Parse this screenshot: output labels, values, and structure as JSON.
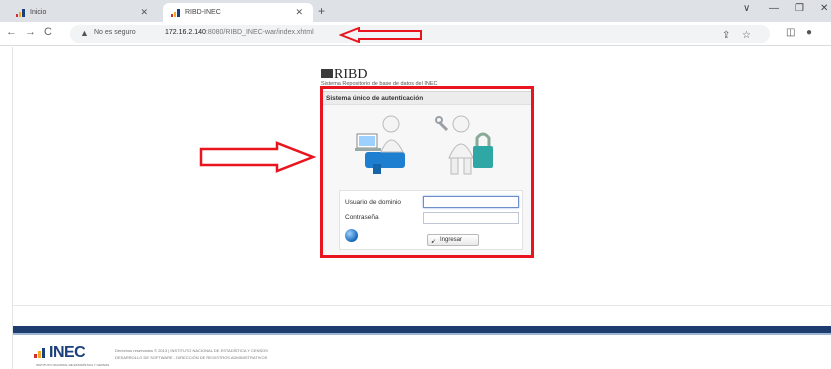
{
  "browser": {
    "tabs": [
      {
        "label": "Inicio",
        "active": false
      },
      {
        "label": "RIBD-INEC",
        "active": true
      }
    ],
    "new_tab_label": "+",
    "address": {
      "security_label": "No es seguro",
      "url_host": "172.16.2.140",
      "url_path": ":8080/RIBD_INEC-war/index.xhtml"
    },
    "window_controls": [
      "∨",
      "—",
      "❐",
      "✕"
    ]
  },
  "page": {
    "app_name": "RIBD",
    "app_subtitle": "Sistema Repositorio de base de datos del INEC",
    "login": {
      "title": "Sistema único de autenticación",
      "username_label": "Usuario de dominio",
      "username_value": "",
      "password_label": "Contraseña",
      "password_value": "",
      "submit_label": "Ingresar"
    },
    "footer": {
      "logo_text": "INEC",
      "logo_tagline": "INSTITUTO NACIONAL DE ESTADÍSTICA Y CENSOS",
      "copyright": "Derechos reservados © 2013 | INSTITUTO NACIONAL DE ESTADÍSTICA Y CENSOS",
      "dev_credit": "DESARROLLO DE SOFTWARE - DIRECCIÓN DE REGISTROS ADMINISTRATIVOS"
    }
  },
  "annotations": {
    "arrow_color": "#e8141e",
    "box_color": "#e8141e"
  },
  "colors": {
    "brand_blue": "#1f3c6e",
    "brand_light": "#9db5d6"
  }
}
